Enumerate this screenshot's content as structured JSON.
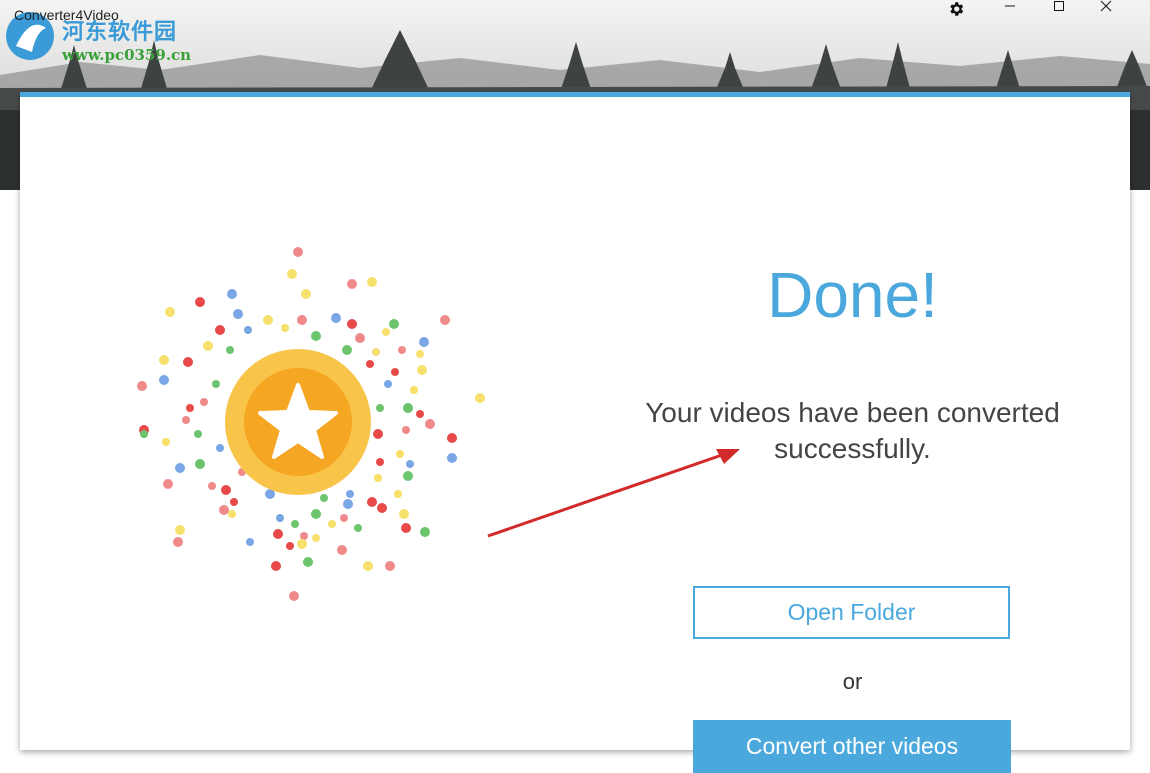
{
  "window": {
    "title": "Converter4Video",
    "settings_icon": "gear-icon",
    "minimize_icon": "minimize-icon",
    "maximize_icon": "maximize-icon",
    "close_icon": "close-icon"
  },
  "watermark": {
    "line1": "河东软件园",
    "line2": "www.pc0359.cn"
  },
  "result": {
    "heading": "Done!",
    "message": "Your videos have been converted successfully.",
    "open_folder_label": "Open Folder",
    "or_label": "or",
    "convert_other_label": "Convert other videos",
    "badge_icon": "star-icon"
  },
  "colors": {
    "accent": "#4aa8dc",
    "badge_outer": "#f8c44a",
    "badge_inner": "#f5a623",
    "arrow": "#d22a2a"
  }
}
